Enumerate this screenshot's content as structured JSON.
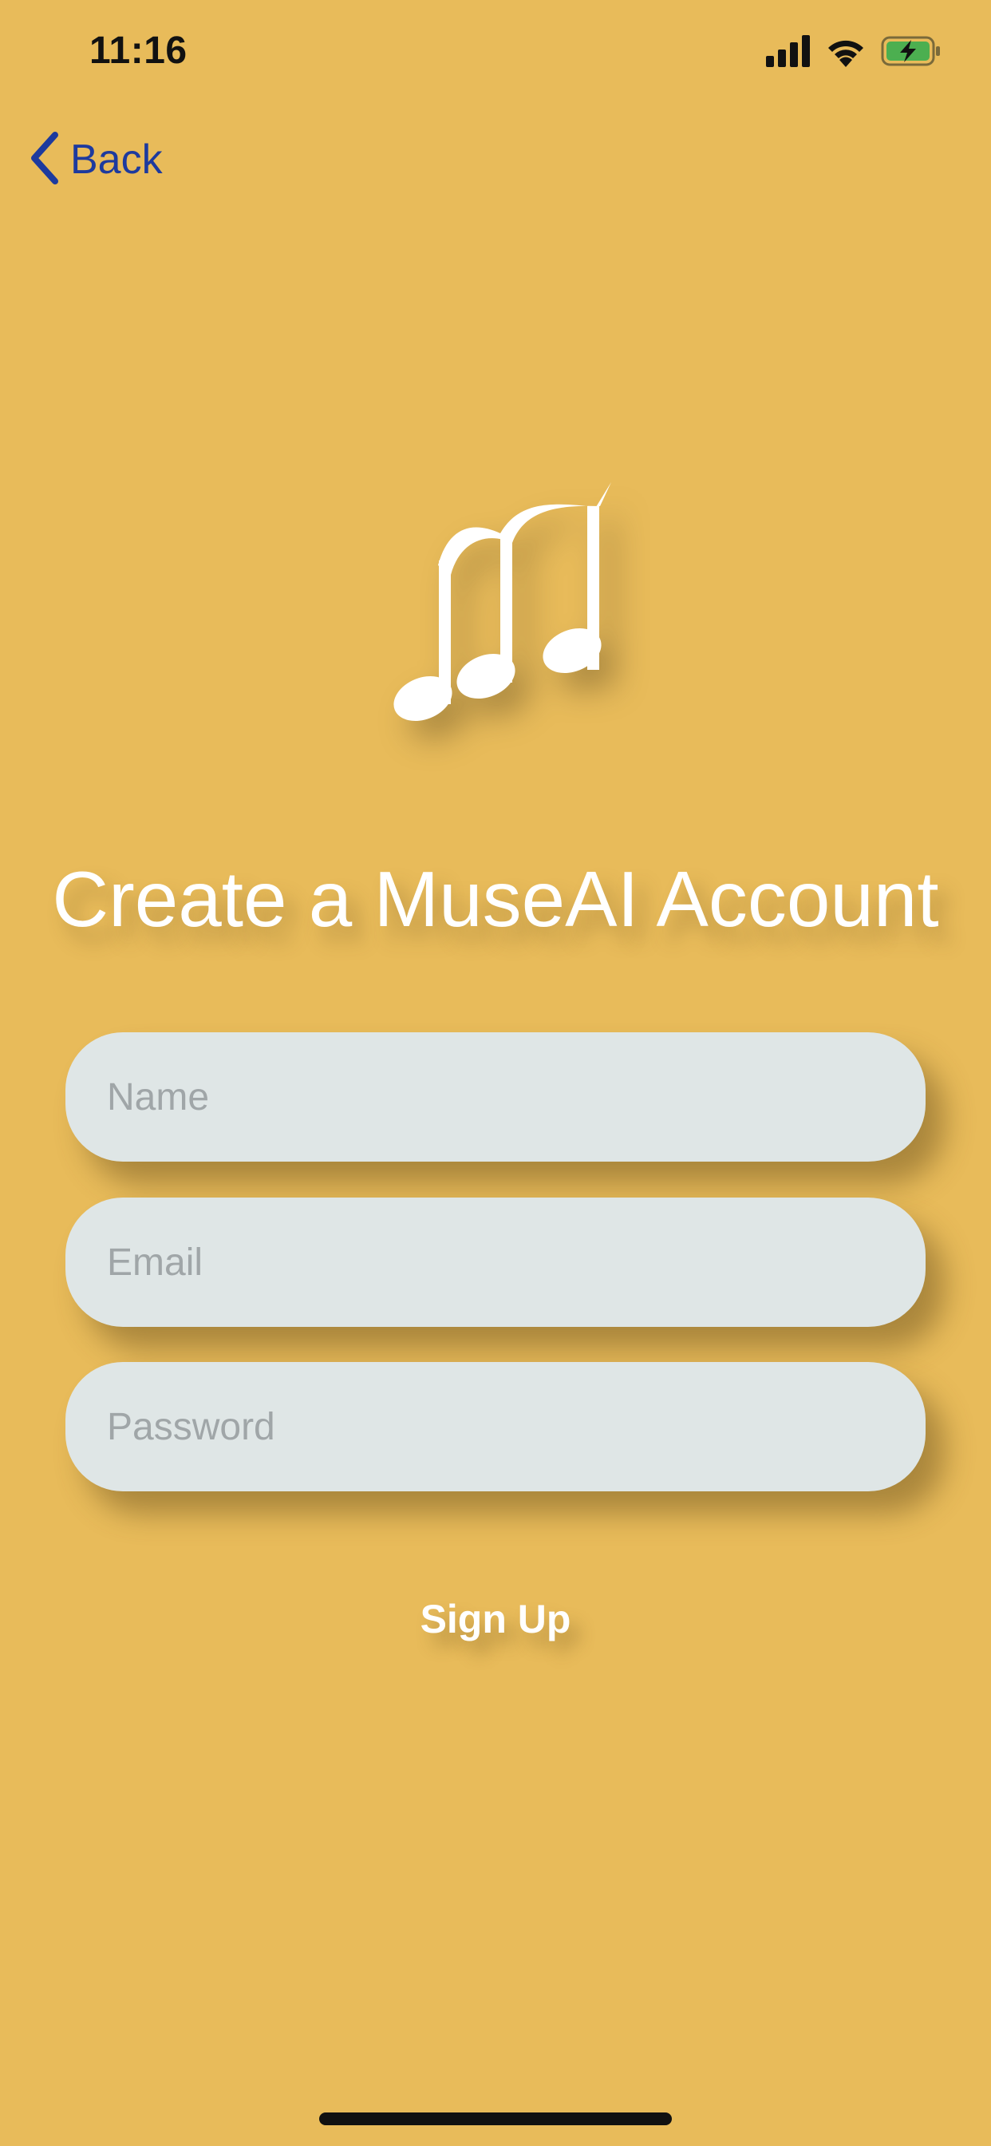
{
  "status_bar": {
    "time": "11:16",
    "icons": [
      "cellular-signal-icon",
      "wifi-icon",
      "battery-charging-icon"
    ],
    "battery_color": "#4CAF50"
  },
  "nav": {
    "back_label": "Back",
    "back_icon": "chevron-left-icon"
  },
  "logo": {
    "icon": "music-notes-icon"
  },
  "title": "Create a MuseAI Account",
  "form": {
    "name": {
      "placeholder": "Name",
      "value": ""
    },
    "email": {
      "placeholder": "Email",
      "value": ""
    },
    "password": {
      "placeholder": "Password",
      "value": ""
    }
  },
  "signup_label": "Sign Up",
  "colors": {
    "background": "#E8BB5A",
    "accent_link": "#1D3A9E",
    "field_background": "#DFE6E6",
    "text_on_background": "#FFFFFF"
  }
}
